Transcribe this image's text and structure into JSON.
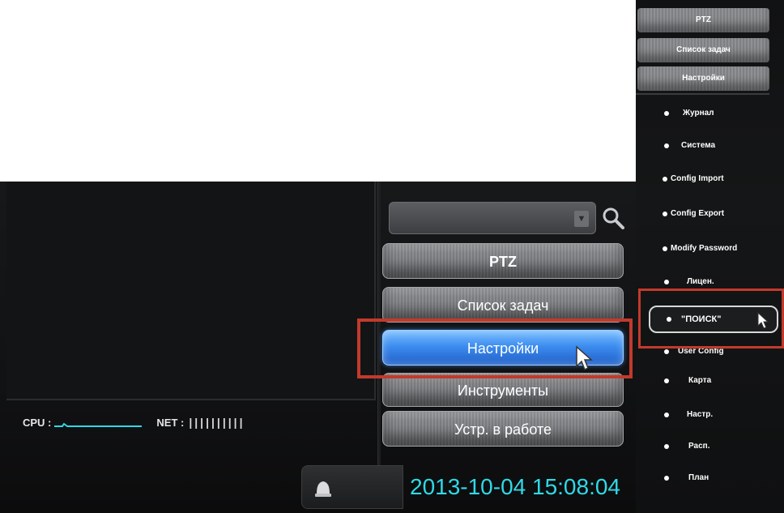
{
  "left_panel": {
    "stats": {
      "cpu_label": "CPU :",
      "net_label": "NET :",
      "net_bars": "||||||||||"
    },
    "search": {
      "placeholder": ""
    },
    "menu": {
      "ptz": "PTZ",
      "tasks": "Список задач",
      "settings": "Настройки",
      "tools": "Инструменты",
      "devices": "Устр. в работе"
    },
    "datetime": "2013-10-04 15:08:04"
  },
  "right_panel": {
    "headers": {
      "ptz": "PTZ",
      "tasks": "Список задач",
      "settings": "Настройки"
    },
    "items": [
      "Журнал",
      "Система",
      "Config Import",
      "Config Export",
      "Modify Password",
      "Лицен.",
      "\"ПОИСК\"",
      "User Config",
      "Карта",
      "Настр.",
      "Расп.",
      "План"
    ]
  },
  "colors": {
    "accent_active": "#3d8df0",
    "datetime_color": "#2fd9e8",
    "highlight_border": "#c23a2c"
  },
  "icons": [
    "search-icon",
    "combo-arrow-icon",
    "cursor-icon",
    "bell-icon"
  ]
}
